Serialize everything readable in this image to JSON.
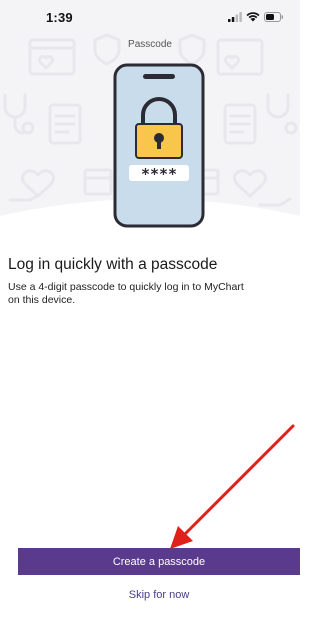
{
  "status_bar": {
    "time": "1:39",
    "icons": [
      "cellular-signal-icon",
      "wifi-icon",
      "battery-icon"
    ]
  },
  "nav": {
    "title": "Passcode"
  },
  "hero": {
    "illustration": "phone-with-padlock",
    "passcode_mask": "****",
    "background_icons": [
      "folder-icon",
      "heart-icon",
      "stethoscope-icon",
      "document-icon",
      "calendar-icon",
      "shield-icon",
      "hand-heart-icon"
    ]
  },
  "content": {
    "headline": "Log in quickly with a passcode",
    "description": "Use a 4-digit passcode to quickly log in to MyChart\non this device."
  },
  "actions": {
    "create_label": "Create a passcode",
    "skip_label": "Skip for now"
  },
  "colors": {
    "primary": "#5a3a8c",
    "link": "#4a3a8c",
    "phone_screen": "#c9dcec",
    "lock_body": "#f7c64a",
    "annotation": "#e0201b"
  }
}
